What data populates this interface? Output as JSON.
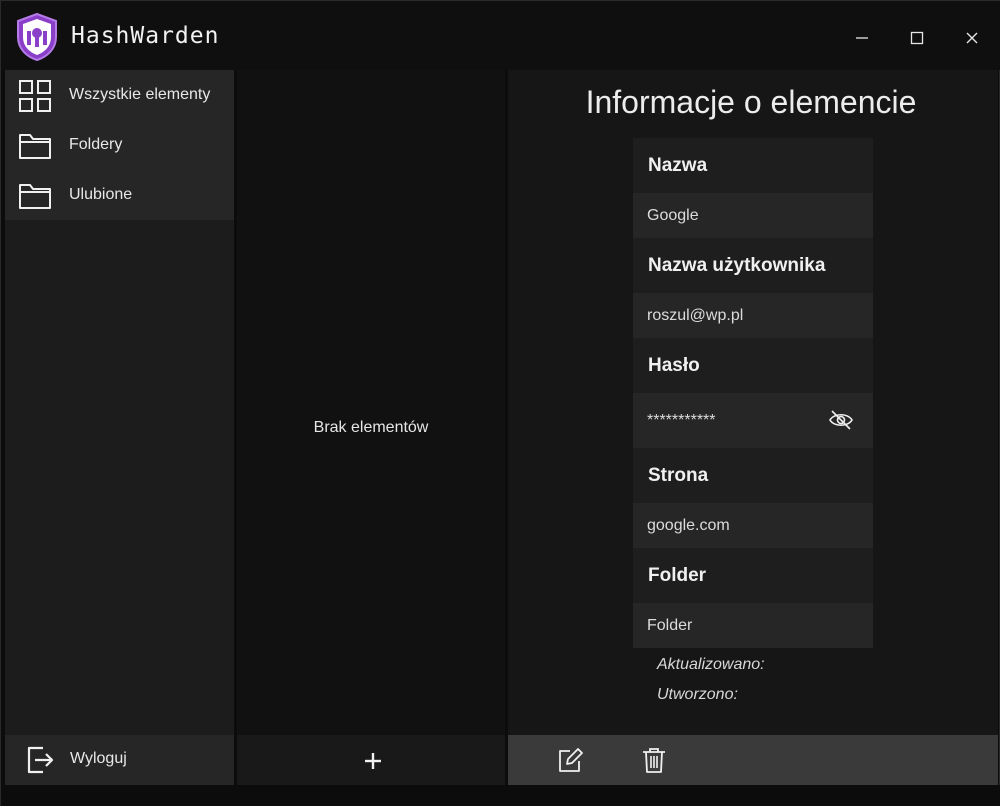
{
  "app": {
    "title": "HashWarden",
    "logo_icon": "shield-lock-logo",
    "accent": "#9b4fd6"
  },
  "window_controls": {
    "minimize_icon": "minimize-icon",
    "maximize_icon": "maximize-icon",
    "close_icon": "close-icon"
  },
  "sidebar": {
    "items": [
      {
        "label": "Wszystkie elementy",
        "icon": "grid-icon"
      },
      {
        "label": "Foldery",
        "icon": "folder-icon"
      },
      {
        "label": "Ulubione",
        "icon": "folder-icon"
      }
    ],
    "logout": {
      "label": "Wyloguj",
      "icon": "logout-icon"
    }
  },
  "list": {
    "empty_text": "Brak elementów",
    "add_icon": "plus-icon"
  },
  "details": {
    "title": "Informacje o elemencie",
    "fields": {
      "name_label": "Nazwa",
      "name_value": "Google",
      "username_label": "Nazwa użytkownika",
      "username_value": "roszul@wp.pl",
      "password_label": "Hasło",
      "password_value": "***********",
      "site_label": "Strona",
      "site_value": "google.com",
      "folder_label": "Folder",
      "folder_value": "Folder"
    },
    "updated_label": "Aktualizowano:",
    "created_label": "Utworzono:",
    "actions": {
      "edit_icon": "edit-icon",
      "delete_icon": "trash-icon"
    }
  }
}
